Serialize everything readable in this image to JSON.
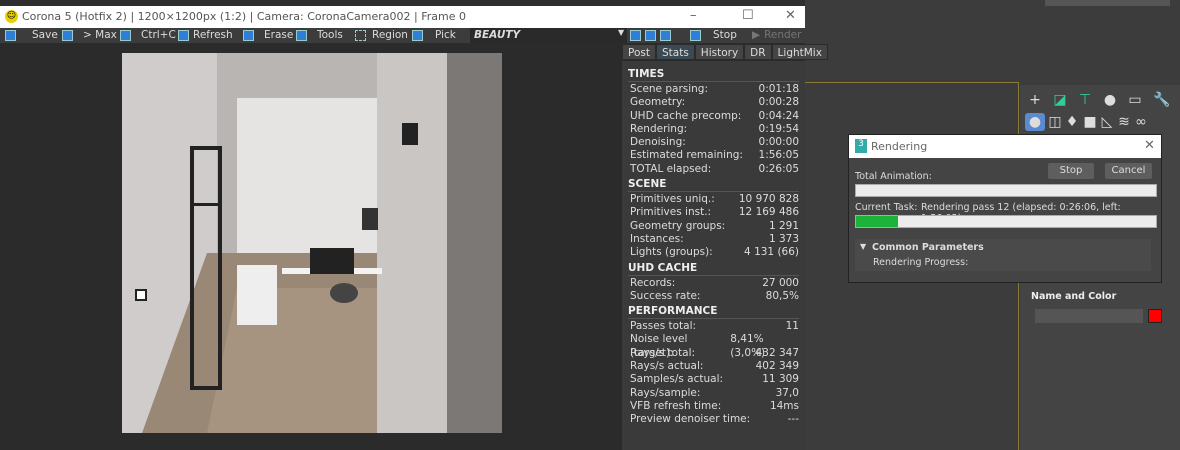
{
  "corona": {
    "title": "Corona 5 (Hotfix 2) | 1200×1200px (1:2) | Camera: CoronaCamera002 | Frame 0",
    "toolbar": {
      "save": "Save",
      "max": "> Max",
      "copy": "Ctrl+C",
      "refresh": "Refresh",
      "erase": "Erase",
      "tools": "Tools",
      "region": "Region",
      "pick": "Pick",
      "channel": "BEAUTY",
      "stop": "Stop",
      "render": "Render"
    },
    "tabs": [
      "Post",
      "Stats",
      "History",
      "DR",
      "LightMix"
    ],
    "active_tab": "Stats",
    "stats": {
      "times": {
        "title": "TIMES",
        "rows": [
          [
            "Scene parsing:",
            "0:01:18"
          ],
          [
            "Geometry:",
            "0:00:28"
          ],
          [
            "UHD cache precomp:",
            "0:04:24"
          ],
          [
            "Rendering:",
            "0:19:54"
          ],
          [
            "Denoising:",
            "0:00:00"
          ],
          [
            "Estimated remaining:",
            "1:56:05"
          ],
          [
            "TOTAL elapsed:",
            "0:26:05"
          ]
        ]
      },
      "scene": {
        "title": "SCENE",
        "rows": [
          [
            "Primitives uniq.:",
            "10 970 828"
          ],
          [
            "Primitives inst.:",
            "12 169 486"
          ],
          [
            "Geometry groups:",
            "1 291"
          ],
          [
            "Instances:",
            "1 373"
          ],
          [
            "Lights (groups):",
            "4 131 (66)"
          ]
        ]
      },
      "uhd": {
        "title": "UHD CACHE",
        "rows": [
          [
            "Records:",
            "27 000"
          ],
          [
            "Success rate:",
            "80,5%"
          ]
        ]
      },
      "perf": {
        "title": "PERFORMANCE",
        "rows": [
          [
            "Passes total:",
            "11"
          ],
          [
            "Noise level (target):",
            "8,41% (3,0%)"
          ],
          [
            "Rays/s total:",
            "432 347"
          ],
          [
            "Rays/s actual:",
            "402 349"
          ],
          [
            "Samples/s actual:",
            "11 309"
          ],
          [
            "Rays/sample:",
            "37,0"
          ],
          [
            "VFB refresh time:",
            "14ms"
          ],
          [
            "Preview denoiser time:",
            "---"
          ]
        ]
      }
    }
  },
  "dialog": {
    "title": "Rendering",
    "stop": "Stop",
    "cancel": "Cancel",
    "total_label": "Total Animation:",
    "total_progress": 0,
    "task_label": "Current Task:",
    "task_text": "Rendering pass 12 (elapsed: 0:26:06, left: 1:56:02)",
    "task_progress": 0.14,
    "rollout": "Common Parameters",
    "progress_label": "Rendering Progress:"
  },
  "max": {
    "name_color_title": "Name and Color",
    "object_color": "#ff0000"
  }
}
